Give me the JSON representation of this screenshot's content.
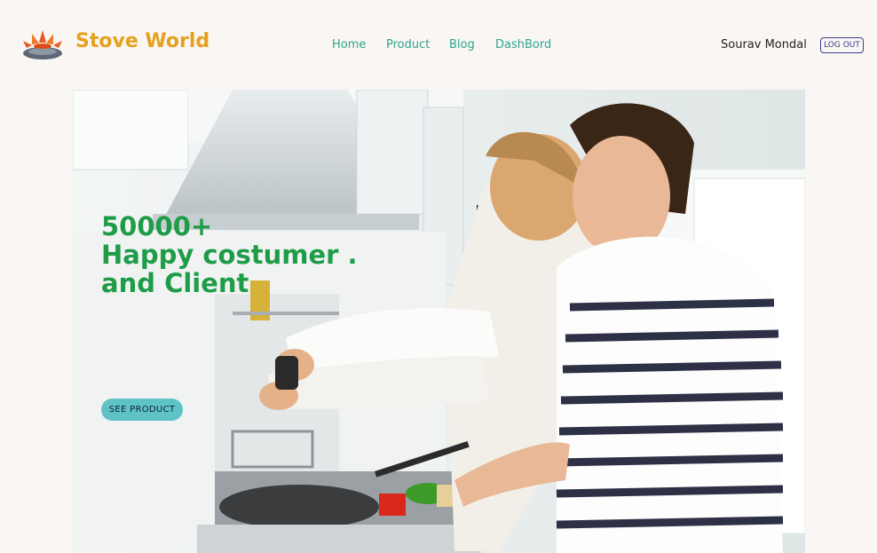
{
  "header": {
    "brand": "Stove World",
    "logo_icon": "stove-burner-icon"
  },
  "nav": {
    "items": [
      {
        "label": "Home"
      },
      {
        "label": "Product"
      },
      {
        "label": "Blog"
      },
      {
        "label": "DashBord"
      }
    ]
  },
  "user": {
    "name": "Sourav Mondal",
    "logout_label": "LOG OUT"
  },
  "hero": {
    "line1": "50000+",
    "line2": "Happy costumer .",
    "line3": "and Client",
    "button_label": "SEE PRODUCT",
    "image_desc_icon": "couple-cooking-photo"
  },
  "colors": {
    "background": "#f9f6f3",
    "brand": "#e6a020",
    "nav_link": "#2fa58e",
    "hero_text": "#1f9c47",
    "button": "#5ec2c6",
    "logout_border": "#3b3d8f"
  }
}
